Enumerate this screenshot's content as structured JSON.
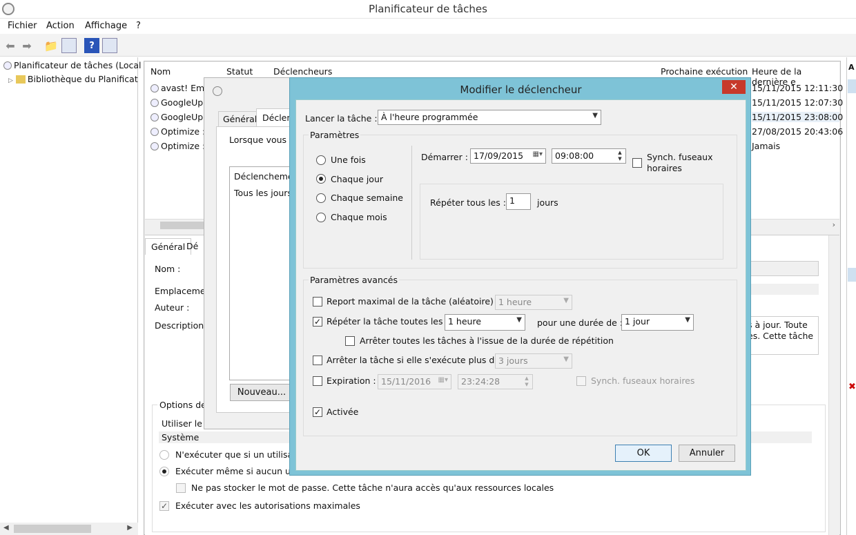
{
  "window": {
    "title": "Planificateur de tâches"
  },
  "menu": [
    "Fichier",
    "Action",
    "Affichage",
    "?"
  ],
  "toolbar": {
    "back": "back-arrow-icon",
    "forward": "forward-arrow-icon",
    "help": "?"
  },
  "tree": {
    "root": "Planificateur de tâches (Local",
    "library": "Bibliothèque du Planificat"
  },
  "tasklist": {
    "columns": [
      "Nom",
      "Statut",
      "Déclencheurs",
      "Prochaine exécution",
      "Heure de la dernière e"
    ],
    "rows": [
      {
        "name": "avast! Eme",
        "last": "15/11/2015 12:11:30"
      },
      {
        "name": "GoogleUp",
        "last": "15/11/2015 12:07:30"
      },
      {
        "name": "GoogleUp",
        "last": "15/11/2015 23:08:00"
      },
      {
        "name": "Optimize :",
        "last": "27/08/2015 20:43:06"
      },
      {
        "name": "Optimize :",
        "last": "Jamais"
      }
    ]
  },
  "details": {
    "tab_general": "Général",
    "tab_other": "Dé",
    "name_label": "Nom :",
    "location_label": "Emplaceme",
    "author_label": "Auteur :",
    "description_label": "Description",
    "desc_text_1": "s à jour. Toute",
    "desc_text_2": "es. Cette tâche",
    "options_label": "Options de",
    "user_label": "Utiliser le c",
    "user_value": "Système",
    "radio1": "N'exécuter que si un utilisate",
    "radio2": "Exécuter même si aucun utili",
    "nostore": "Ne pas stocker le mot de passe. Cette tâche n'aura accès qu'aux ressources locales",
    "highest": "Exécuter avec les autorisations maximales"
  },
  "props_dialog": {
    "tab_general": "Général",
    "tab_triggers": "Déclen",
    "intro": "Lorsque vous c",
    "col_trigger": "Déclencheme",
    "trigger_row": "Tous les jours",
    "new_button": "Nouveau..."
  },
  "dialog": {
    "title": "Modifier le déclencheur",
    "close": "✕",
    "launch_label": "Lancer la tâche :",
    "launch_value": "À l'heure programmée",
    "params_label": "Paramètres",
    "once": "Une fois",
    "daily": "Chaque jour",
    "weekly": "Chaque semaine",
    "monthly": "Chaque mois",
    "start_label": "Démarrer :",
    "start_date": "17/09/2015",
    "start_time": "09:08:00",
    "sync_tz": "Synch. fuseaux horaires",
    "repeat_every_label": "Répéter tous les :",
    "repeat_every_value": "1",
    "repeat_every_unit": "jours",
    "advanced_label": "Paramètres avancés",
    "delay_label": "Report maximal de la tâche (aléatoire) :",
    "delay_value": "1 heure",
    "repeat_task_label": "Répéter la tâche toutes les :",
    "repeat_task_value": "1 heure",
    "duration_label": "pour une durée de :",
    "duration_value": "1 jour",
    "stop_all_label": "Arrêter toutes les tâches à l'issue de la durée de répétition",
    "stop_if_label": "Arrêter la tâche si elle s'exécute plus de :",
    "stop_if_value": "3 jours",
    "expire_label": "Expiration :",
    "expire_date": "15/11/2016",
    "expire_time": "23:24:28",
    "expire_sync": "Synch. fuseaux horaires",
    "enabled_label": "Activée",
    "ok": "OK",
    "cancel": "Annuler"
  }
}
